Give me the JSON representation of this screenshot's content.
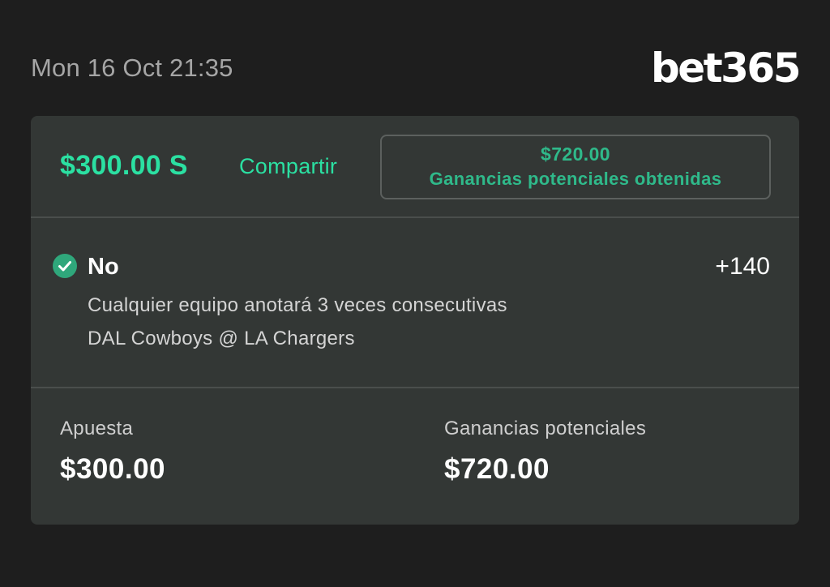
{
  "header": {
    "timestamp": "Mon 16 Oct 21:35",
    "brand": "bet365"
  },
  "bet": {
    "stake_label": "$300.00 S",
    "share_label": "Compartir",
    "winnings_amount": "$720.00",
    "winnings_label": "Ganancias potenciales obtenidas"
  },
  "selection": {
    "status_icon": "check-circle-icon",
    "status_color": "#2fa77b",
    "name": "No",
    "odds": "+140",
    "market": "Cualquier equipo anotará 3 veces consecutivas",
    "event": "DAL Cowboys @ LA Chargers"
  },
  "summary": {
    "stake_label": "Apuesta",
    "stake_value": "$300.00",
    "payout_label": "Ganancias potenciales",
    "payout_value": "$720.00"
  },
  "colors": {
    "accent": "#2be0a2",
    "accent_muted": "#2fb98a",
    "background": "#1e1e1e",
    "card": "#333735"
  }
}
